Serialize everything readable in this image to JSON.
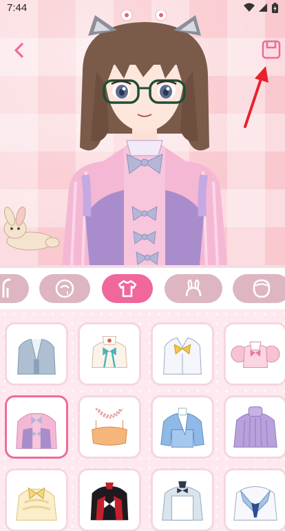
{
  "status_bar": {
    "time": "7:44",
    "icons": [
      "wifi-icon",
      "signal-icon",
      "battery-charging-icon"
    ]
  },
  "header": {
    "back_icon": "chevron-left-icon",
    "save_icon": "save-icon",
    "accent_color": "#f0679b"
  },
  "preview": {
    "background_color": "#f9c9cf",
    "character": "anime-girl-avatar",
    "decoration": "plush-bunny"
  },
  "tabs": [
    {
      "icon": "hair-icon",
      "active": false
    },
    {
      "icon": "face-icon",
      "active": false
    },
    {
      "icon": "shirt-icon",
      "active": true
    },
    {
      "icon": "bunny-ears-icon",
      "active": false
    },
    {
      "icon": "head-outline-icon",
      "active": false
    }
  ],
  "items": [
    {
      "icon": "blue-kimono-top",
      "selected": false
    },
    {
      "icon": "white-crop-top-teal-bow",
      "selected": false
    },
    {
      "icon": "white-shirt-yellow-bow",
      "selected": false
    },
    {
      "icon": "pink-puff-sleeve-top",
      "selected": false
    },
    {
      "icon": "pink-purple-striped-top",
      "selected": true
    },
    {
      "icon": "orange-bandeau-pearl-necklace",
      "selected": false
    },
    {
      "icon": "blue-kimono-wrap",
      "selected": false
    },
    {
      "icon": "purple-turtleneck-sweater",
      "selected": false
    },
    {
      "icon": "cream-frilly-blouse",
      "selected": false
    },
    {
      "icon": "red-black-gothic-dress",
      "selected": false
    },
    {
      "icon": "maid-apron-top",
      "selected": false
    },
    {
      "icon": "sailor-uniform-top",
      "selected": false
    }
  ]
}
